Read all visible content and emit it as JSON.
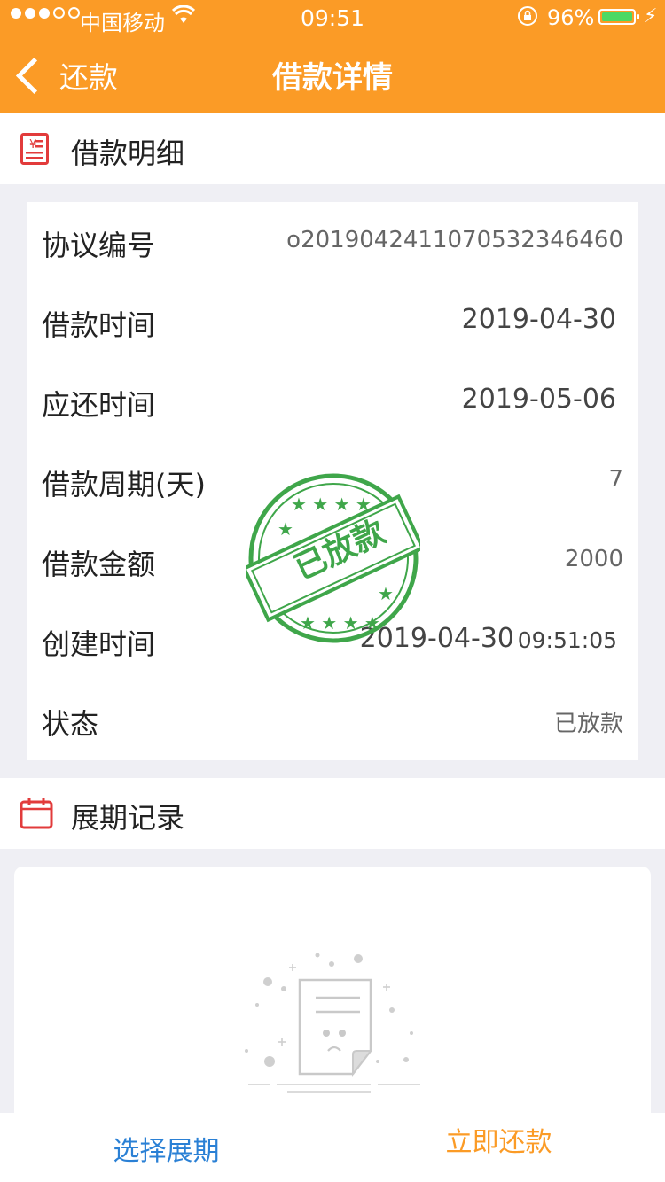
{
  "status_bar": {
    "carrier": "中国移动",
    "time": "09:51",
    "battery": "96%",
    "battery_level": 0.96
  },
  "nav": {
    "back_label": "还款",
    "title": "借款详情"
  },
  "loan_detail": {
    "section_title": "借款明细",
    "rows": [
      {
        "label": "协议编号",
        "value": "o20190424110705323464​60"
      },
      {
        "label": "借款时间",
        "value": "2019-04-30"
      },
      {
        "label": "应还时间",
        "value": "2019-05-06"
      },
      {
        "label": "借款周期(天)",
        "value": "7"
      },
      {
        "label": "借款金额",
        "value": "2000"
      },
      {
        "label": "创建时间",
        "value": "2019-04-30",
        "value2": "09:51:05"
      },
      {
        "label": "状态",
        "value": "已放款"
      }
    ],
    "stamp_text": "已放款",
    "stamp_color": "#3fa64a"
  },
  "extension": {
    "section_title": "展期记录"
  },
  "actions": {
    "left": "选择展期",
    "right": "立即还款"
  },
  "colors": {
    "brand": "#fb9b26",
    "link_blue": "#2a80d5",
    "icon_red": "#e23b3b"
  }
}
